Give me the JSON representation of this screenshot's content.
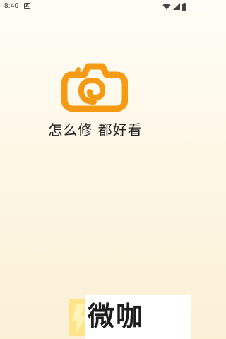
{
  "status_bar": {
    "time": "8:40",
    "notification_icon": "a-notification-icon",
    "wifi_icon": "wifi-icon",
    "signal_icon": "signal-icon",
    "battery_icon": "battery-icon"
  },
  "splash": {
    "logo_icon": "camera-logo-icon",
    "slogan": "怎么修 都好看",
    "brand_name": "微咖",
    "brand_mark_icon": "brand-bolt-icon"
  },
  "colors": {
    "logo_orange": "#f59a12",
    "text": "#222222",
    "background_top": "#fffdf6",
    "background_bottom": "#fbf0d6",
    "brand_mark_yellow": "#ffe48a"
  }
}
